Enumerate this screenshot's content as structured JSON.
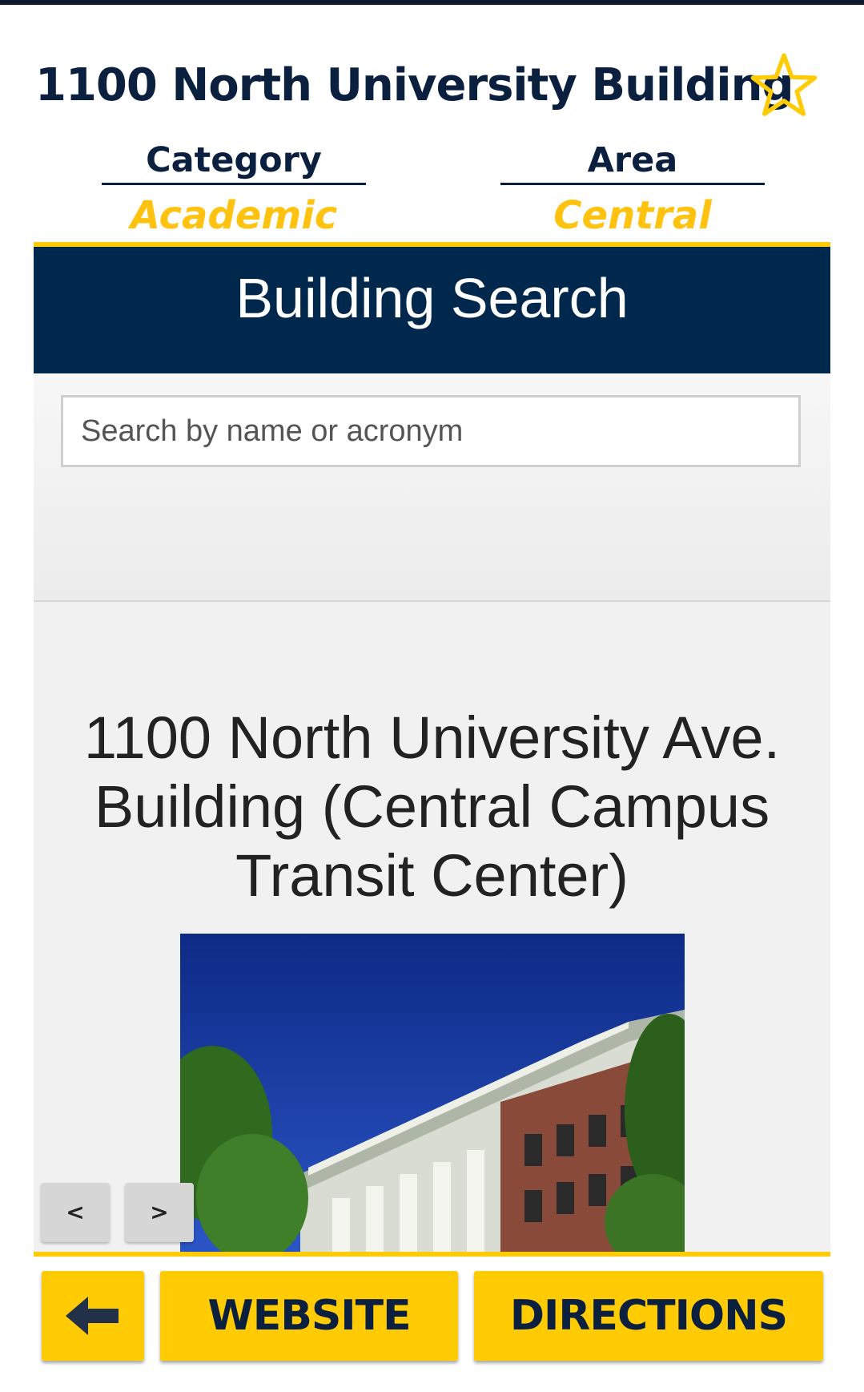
{
  "header": {
    "title": "1100 North University Building",
    "favorite_icon": "star-outline-icon"
  },
  "meta": {
    "category_label": "Category",
    "category_value": "Academic",
    "area_label": "Area",
    "area_value": "Central"
  },
  "search_panel": {
    "title": "Building Search",
    "placeholder": "Search by name or acronym",
    "value": ""
  },
  "building": {
    "name": "1100 North University Ave. Building (Central Campus Transit Center)",
    "photo_icon": "building-photo"
  },
  "gallery": {
    "prev_label": "<",
    "next_label": ">"
  },
  "actions": {
    "back_icon": "arrow-left-icon",
    "website_label": "WEBSITE",
    "directions_label": "DIRECTIONS"
  },
  "colors": {
    "navy": "#00274c",
    "maize": "#ffcb05",
    "panel_bg": "#f1f1f1"
  }
}
